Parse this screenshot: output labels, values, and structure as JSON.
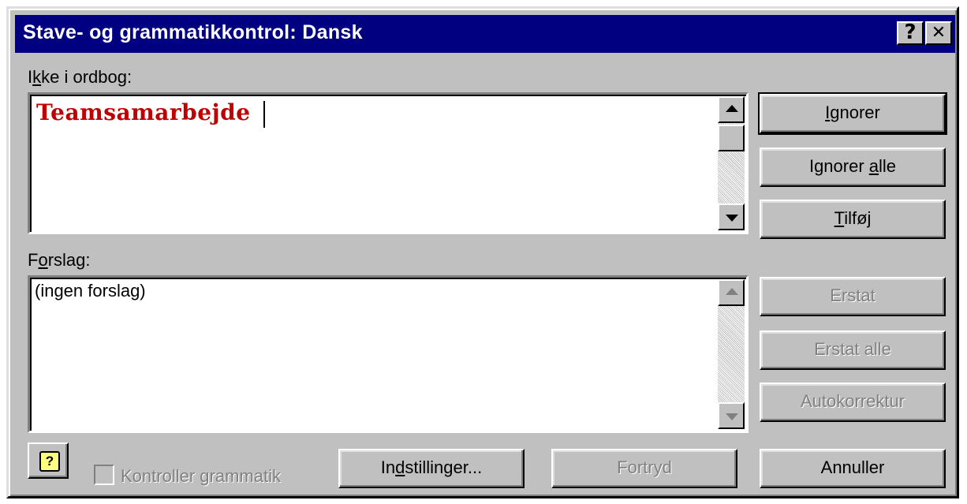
{
  "window": {
    "title": "Stave- og grammatikkontrol: Dansk",
    "help_label": "?",
    "close_label": "✕"
  },
  "not_in_dictionary": {
    "label_pre": "I",
    "label_ul": "k",
    "label_post": "ke i ordbog:",
    "word": "Teamsamarbejde"
  },
  "suggestions": {
    "label_pre": "F",
    "label_ul": "o",
    "label_post": "rslag:",
    "items": [
      "(ingen forslag)"
    ]
  },
  "buttons": {
    "ignore": {
      "pre": "",
      "ul": "I",
      "post": "gnorer"
    },
    "ignore_all": {
      "pre": "Ignorer ",
      "ul": "a",
      "post": "lle"
    },
    "add": {
      "pre": "",
      "ul": "T",
      "post": "ilføj"
    },
    "replace": "Erstat",
    "replace_all": "Erstat alle",
    "autocorrect": "Autokorrektur",
    "options": {
      "pre": "In",
      "ul": "d",
      "post": "stillinger..."
    },
    "undo": "Fortryd",
    "cancel": "Annuller"
  },
  "check_grammar": {
    "label": "Kontroller grammatik",
    "checked": false
  },
  "icons": {
    "help_assistant": "help-icon"
  }
}
